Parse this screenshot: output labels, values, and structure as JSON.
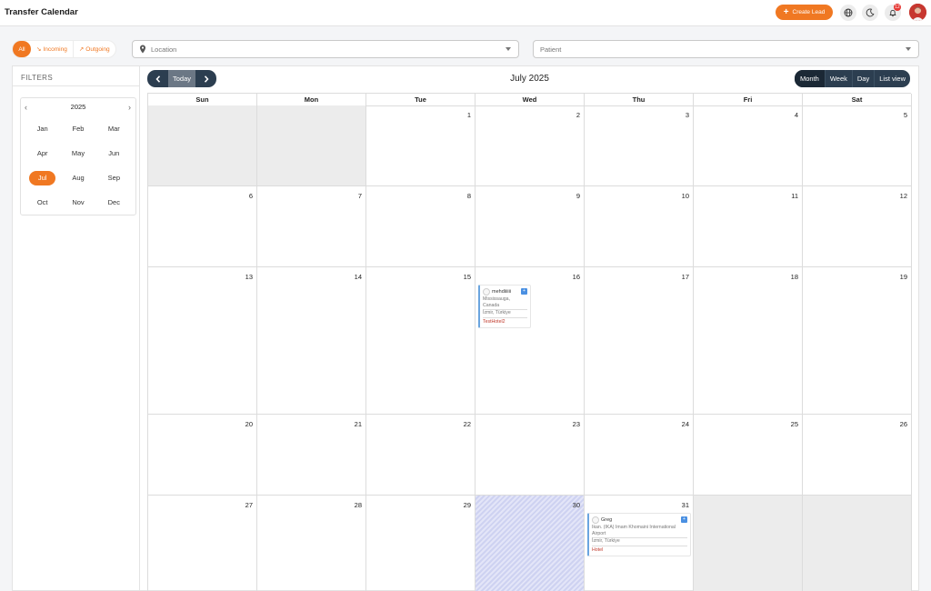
{
  "app": {
    "title": "Transfer Calendar"
  },
  "header": {
    "create_lead_label": "Create Lead",
    "notification_count": "12",
    "icons": [
      "globe-icon",
      "moon-icon",
      "bell-icon",
      "user-avatar"
    ]
  },
  "filters_bar": {
    "direction": {
      "all": "All",
      "incoming": "Incoming",
      "outgoing": "Outgoing",
      "selected": "All"
    },
    "location": {
      "placeholder": "Location"
    },
    "patient": {
      "placeholder": "Patient"
    }
  },
  "sidebar": {
    "title": "FILTERS",
    "year": "2025",
    "months": [
      "Jan",
      "Feb",
      "Mar",
      "Apr",
      "May",
      "Jun",
      "Jul",
      "Aug",
      "Sep",
      "Oct",
      "Nov",
      "Dec"
    ],
    "selected_month": "Jul"
  },
  "calendar": {
    "title": "July 2025",
    "today_label": "Today",
    "views": [
      "Month",
      "Week",
      "Day",
      "List view"
    ],
    "active_view": "Month",
    "weekdays": [
      "Sun",
      "Mon",
      "Tue",
      "Wed",
      "Thu",
      "Fri",
      "Sat"
    ],
    "weeks": [
      [
        "",
        "",
        "1",
        "2",
        "3",
        "4",
        "5"
      ],
      [
        "6",
        "7",
        "8",
        "9",
        "10",
        "11",
        "12"
      ],
      [
        "13",
        "14",
        "15",
        "16",
        "17",
        "18",
        "19"
      ],
      [
        "20",
        "21",
        "22",
        "23",
        "24",
        "25",
        "26"
      ],
      [
        "27",
        "28",
        "29",
        "30",
        "31",
        "",
        ""
      ]
    ],
    "today_date": "30",
    "events": [
      {
        "date": "16",
        "name": "mehdiiiiii",
        "from": "Mississauga, Canada",
        "to": "İzmir, Türkiye",
        "hotel": "TestHotel2"
      },
      {
        "date": "31",
        "name": "Greg",
        "from": "Ikan. (IKA) Imam Khomaini International Airport",
        "to": "İzmir, Türkiye",
        "hotel": "Hotel"
      }
    ]
  },
  "colors": {
    "accent": "#f07822",
    "nav_dark": "#2c3e50",
    "event_border": "#6aa5df",
    "hotel_text": "#c0392b"
  }
}
